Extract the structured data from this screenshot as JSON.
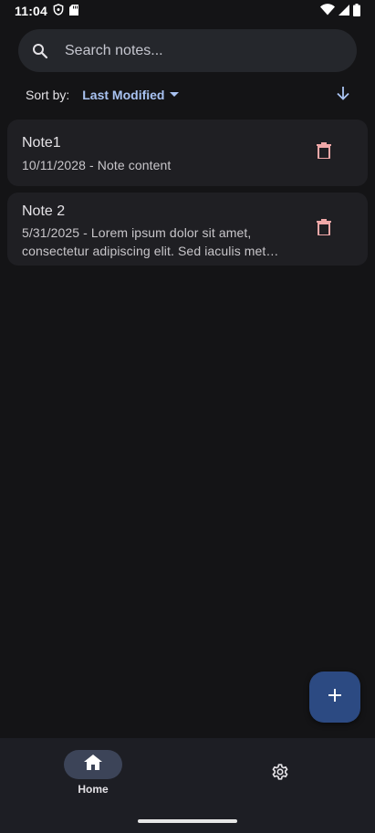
{
  "status_bar": {
    "time": "11:04",
    "icons": [
      "shield-icon",
      "sd-card-icon",
      "wifi-icon",
      "signal-icon",
      "battery-icon"
    ]
  },
  "search": {
    "placeholder": "Search notes...",
    "value": "",
    "icon": "search-icon"
  },
  "sort": {
    "label": "Sort by:",
    "selected": "Last Modified",
    "direction_icon": "arrow-down-icon",
    "direction": "descending"
  },
  "notes": [
    {
      "title": "Note1",
      "preview": "10/11/2028 - Note content",
      "delete_icon": "trash-icon"
    },
    {
      "title": "Note 2",
      "preview": "5/31/2025 - Lorem ipsum dolor sit amet, consectetur adipiscing elit. Sed iaculis met…",
      "delete_icon": "trash-icon"
    }
  ],
  "fab": {
    "icon": "plus-icon"
  },
  "bottom_nav": {
    "items": [
      {
        "label": "Home",
        "icon": "home-icon",
        "selected": true
      },
      {
        "label": "",
        "icon": "gear-icon",
        "selected": false
      }
    ]
  },
  "colors": {
    "background": "#141416",
    "surface": "#1f1f23",
    "search_bg": "#25272c",
    "accent": "#a9c3f2",
    "delete": "#f0a8a8",
    "fab": "#2c4a82",
    "nav_bg": "#1d1e24",
    "nav_pill": "#3c4458"
  }
}
